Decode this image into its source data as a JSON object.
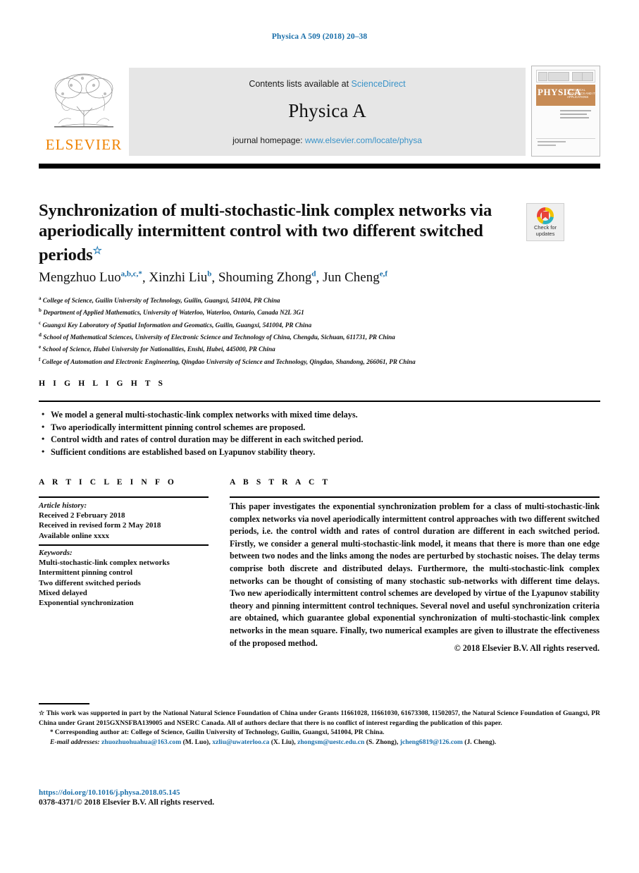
{
  "running_head": "Physica A 509 (2018) 20–38",
  "masthead": {
    "contents_prefix": "Contents lists available at ",
    "sciencedirect": "ScienceDirect",
    "journal_title": "Physica A",
    "homepage_prefix": "journal homepage: ",
    "homepage_url": "www.elsevier.com/locate/physa",
    "publisher_logo_text": "ELSEVIER",
    "cover_title": "PHYSICA",
    "cover_subtitle": "STATISTICAL MECHANICS AND ITS APPLICATIONS",
    "link_color": "#3a93c8"
  },
  "article": {
    "title": "Synchronization of multi-stochastic-link complex networks via aperiodically intermittent control with two different switched periods",
    "title_footnote_marker": "☆",
    "crossmark": {
      "line1": "Check for",
      "line2": "updates"
    },
    "authors": [
      {
        "name": "Mengzhuo Luo",
        "sup": "a,b,c,*"
      },
      {
        "name": "Xinzhi Liu",
        "sup": "b"
      },
      {
        "name": "Shouming Zhong",
        "sup": "d"
      },
      {
        "name": "Jun Cheng",
        "sup": "e,f"
      }
    ],
    "affiliations": [
      {
        "marker": "a",
        "text": "College of Science, Guilin University of Technology,  Guilin, Guangxi, 541004, PR China"
      },
      {
        "marker": "b",
        "text": "Department of Applied Mathematics, University of Waterloo,  Waterloo, Ontario, Canada N2L 3G1"
      },
      {
        "marker": "c",
        "text": "Guangxi Key Laboratory of Spatial Information and Geomatics, Guilin, Guangxi, 541004, PR China"
      },
      {
        "marker": "d",
        "text": "School of Mathematical Sciences, University of Electronic Science and Technology of China, Chengdu, Sichuan, 611731, PR China"
      },
      {
        "marker": "e",
        "text": "School of Science, Hubei University for Nationalities, Enshi, Hubei, 445000, PR China"
      },
      {
        "marker": "f",
        "text": "College of Automation and Electronic Engineering, Qingdao University of Science and Technology, Qingdao, Shandong, 266061, PR China"
      }
    ]
  },
  "highlights": {
    "heading": "H I G H L I G H T S",
    "items": [
      "We model a general multi-stochastic-link complex networks with mixed time delays.",
      "Two aperiodically intermittent pinning control schemes are proposed.",
      "Control width and rates of control duration may be different in each switched period.",
      "Sufficient conditions are established based on Lyapunov stability theory."
    ]
  },
  "article_info": {
    "heading": "A R T I C L E   I N F O",
    "history_label": "Article history:",
    "history": [
      "Received 2 February 2018",
      "Received in revised form 2 May 2018",
      "Available online xxxx"
    ],
    "keywords_label": "Keywords:",
    "keywords": [
      "Multi-stochastic-link complex networks",
      "Intermittent pinning control",
      "Two different switched periods",
      "Mixed delayed",
      "Exponential synchronization"
    ]
  },
  "abstract": {
    "heading": "A B S T R A C T",
    "text": "This paper investigates the exponential synchronization problem for a class of multi-stochastic-link complex networks via novel aperiodically intermittent control approaches with two different switched periods, i.e. the control width and rates of control duration are different in each switched period. Firstly, we consider a general multi-stochastic-link model, it means that there is more than one edge between two nodes and the links among the nodes are perturbed by stochastic noises. The delay terms comprise both discrete and distributed delays. Furthermore, the multi-stochastic-link complex networks can be thought of consisting of many stochastic sub-networks with different time delays. Two new aperiodically intermittent control schemes are developed by virtue of the Lyapunov stability theory and pinning intermittent control techniques. Several novel and useful synchronization criteria are obtained, which guarantee global exponential synchronization of multi-stochastic-link complex networks in the mean square. Finally, two numerical examples are given to illustrate the effectiveness of the proposed method.",
    "copyright": "© 2018 Elsevier B.V. All rights reserved."
  },
  "footnotes": {
    "funding_marker": "☆",
    "funding": "This work was supported in part by the National Natural Science Foundation of China under Grants 11661028, 11661030, 61673308, 11502057, the Natural Science Foundation of Guangxi, PR China under Grant 2015GXNSFBA139005 and NSERC Canada. All of authors declare that there is no conflict of interest regarding the publication of this paper.",
    "corresponding_marker": "*",
    "corresponding": "Corresponding author at: College of Science, Guilin University of Technology,  Guilin, Guangxi, 541004, PR China.",
    "email_label": "E-mail addresses:",
    "emails": [
      {
        "address": "zhuozhuohuahua@163.com",
        "owner": "(M. Luo)"
      },
      {
        "address": "xzliu@uwaterloo.ca",
        "owner": "(X. Liu)"
      },
      {
        "address": "zhongsm@uestc.edu.cn",
        "owner": "(S. Zhong)"
      },
      {
        "address": "jcheng6819@126.com",
        "owner": "(J. Cheng)."
      }
    ]
  },
  "footer": {
    "doi": "https://doi.org/10.1016/j.physa.2018.05.145",
    "issn_line": "0378-4371/© 2018 Elsevier B.V. All rights reserved."
  }
}
